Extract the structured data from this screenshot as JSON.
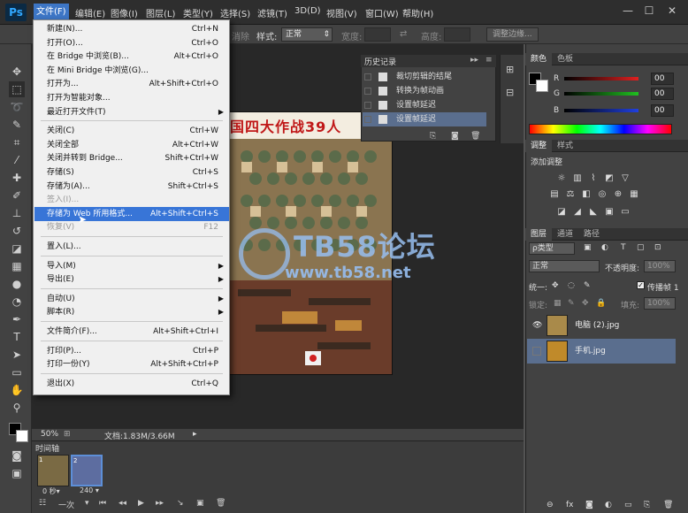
{
  "app": {
    "logo": "Ps"
  },
  "menubar": {
    "items": [
      "文件(F)",
      "编辑(E)",
      "图像(I)",
      "图层(L)",
      "类型(Y)",
      "选择(S)",
      "滤镜(T)",
      "3D(D)",
      "视图(V)",
      "窗口(W)",
      "帮助(H)"
    ],
    "window_controls": [
      "—",
      "☐",
      "✕"
    ]
  },
  "options_bar": {
    "style_label": "样式:",
    "style_value": "正常",
    "width_label": "宽度:",
    "height_label": "高度:",
    "refine_edge": "调整边缘...",
    "hidden_text": "消除"
  },
  "file_menu": {
    "items": [
      {
        "label": "新建(N)...",
        "shortcut": "Ctrl+N"
      },
      {
        "label": "打开(O)...",
        "shortcut": "Ctrl+O"
      },
      {
        "label": "在 Bridge 中浏览(B)...",
        "shortcut": "Alt+Ctrl+O"
      },
      {
        "label": "在 Mini Bridge 中浏览(G)...",
        "shortcut": ""
      },
      {
        "label": "打开为...",
        "shortcut": "Alt+Shift+Ctrl+O"
      },
      {
        "label": "打开为智能对象...",
        "shortcut": ""
      },
      {
        "label": "最近打开文件(T)",
        "shortcut": "",
        "submenu": true
      },
      {
        "label": "关闭(C)",
        "shortcut": "Ctrl+W"
      },
      {
        "label": "关闭全部",
        "shortcut": "Alt+Ctrl+W"
      },
      {
        "label": "关闭并转到 Bridge...",
        "shortcut": "Shift+Ctrl+W"
      },
      {
        "label": "存储(S)",
        "shortcut": "Ctrl+S"
      },
      {
        "label": "存储为(A)...",
        "shortcut": "Shift+Ctrl+S"
      },
      {
        "label": "签入(I)...",
        "shortcut": "",
        "disabled": true
      },
      {
        "label": "存储为 Web 所用格式...",
        "shortcut": "Alt+Shift+Ctrl+S",
        "highlighted": true
      },
      {
        "label": "恢复(V)",
        "shortcut": "F12",
        "disabled": true
      },
      {
        "label": "置入(L)...",
        "shortcut": ""
      },
      {
        "label": "导入(M)",
        "shortcut": "",
        "submenu": true
      },
      {
        "label": "导出(E)",
        "shortcut": "",
        "submenu": true
      },
      {
        "label": "自动(U)",
        "shortcut": "",
        "submenu": true
      },
      {
        "label": "脚本(R)",
        "shortcut": "",
        "submenu": true
      },
      {
        "label": "文件简介(F)...",
        "shortcut": "Alt+Shift+Ctrl+I"
      },
      {
        "label": "打印(P)...",
        "shortcut": "Ctrl+P"
      },
      {
        "label": "打印一份(Y)",
        "shortcut": "Alt+Shift+Ctrl+P"
      },
      {
        "label": "退出(X)",
        "shortcut": "Ctrl+Q"
      }
    ]
  },
  "history": {
    "title": "历史记录",
    "items": [
      "裁切剪辑的结尾",
      "转换为帧动画",
      "设置帧延迟",
      "设置帧延迟"
    ]
  },
  "canvas": {
    "poster_title": "国四大作战39人",
    "watermark": "TB58论坛",
    "watermark_url": "www.tb58.net"
  },
  "status": {
    "zoom": "50%",
    "doc": "文档:1.83M/3.66M"
  },
  "timeline": {
    "title": "时间轴",
    "frames": [
      {
        "index": "1",
        "delay": "0 秒▾"
      },
      {
        "index": "2",
        "delay": "240 ▾"
      }
    ],
    "loop": "一次"
  },
  "color_panel": {
    "tabs": [
      "颜色",
      "色板"
    ],
    "channels": [
      {
        "name": "R",
        "value": "00",
        "color": "#e02020"
      },
      {
        "name": "G",
        "value": "00",
        "color": "#20c020"
      },
      {
        "name": "B",
        "value": "00",
        "color": "#2040e0"
      }
    ]
  },
  "adjustments_panel": {
    "tabs": [
      "调整",
      "样式"
    ],
    "add_label": "添加调整"
  },
  "layers_panel": {
    "tabs": [
      "图层",
      "通道",
      "路径"
    ],
    "filter_kind": "ρ类型",
    "blend_mode": "正常",
    "opacity_label": "不透明度:",
    "opacity_value": "100%",
    "unify_label": "统一:",
    "propagate_label": "传播帧 1",
    "lock_label": "锁定:",
    "fill_label": "填充:",
    "fill_value": "100%",
    "layers": [
      {
        "name": "电脑 (2).jpg",
        "visible": true
      },
      {
        "name": "手机.jpg",
        "visible": false,
        "selected": true
      }
    ]
  }
}
